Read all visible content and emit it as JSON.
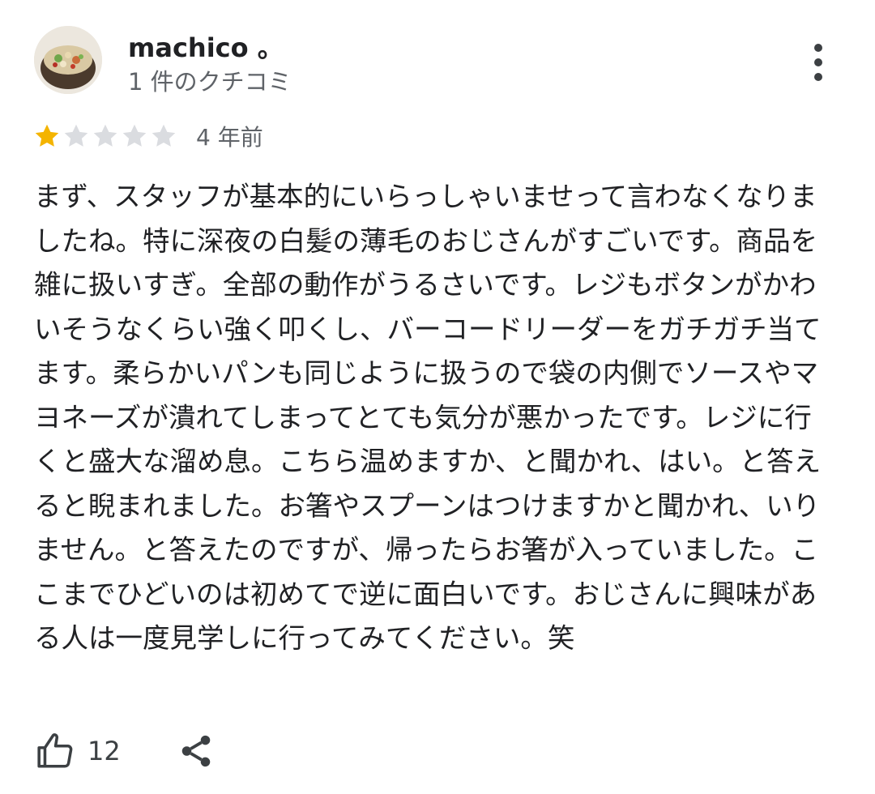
{
  "reviewer": {
    "name": "machico 。",
    "review_count": "1 件のクチコミ"
  },
  "rating": {
    "value": 1,
    "max": 5,
    "filled_color": "#f4b400",
    "empty_color": "#dadce0",
    "time_ago": "4 年前"
  },
  "review": {
    "text": "まず、スタッフが基本的にいらっしゃいませって言わなくなりましたね。特に深夜の白髪の薄毛のおじさんがすごいです。商品を雑に扱いすぎ。全部の動作がうるさいです。レジもボタンがかわいそうなくらい強く叩くし、バーコードリーダーをガチガチ当てます。柔らかいパンも同じように扱うので袋の内側でソースやマヨネーズが潰れてしまってとても気分が悪かったです。レジに行くと盛大な溜め息。こちら温めますか、と聞かれ、はい。と答えると睨まれました。お箸やスプーンはつけますかと聞かれ、いりません。と答えたのですが、帰ったらお箸が入っていました。ここまでひどいのは初めてで逆に面白いです。おじさんに興味がある人は一度見学しに行ってみてください。笑"
  },
  "actions": {
    "like_count": "12",
    "like_icon": "thumbs-up-icon",
    "share_icon": "share-icon",
    "more_icon": "more-vert-icon"
  }
}
